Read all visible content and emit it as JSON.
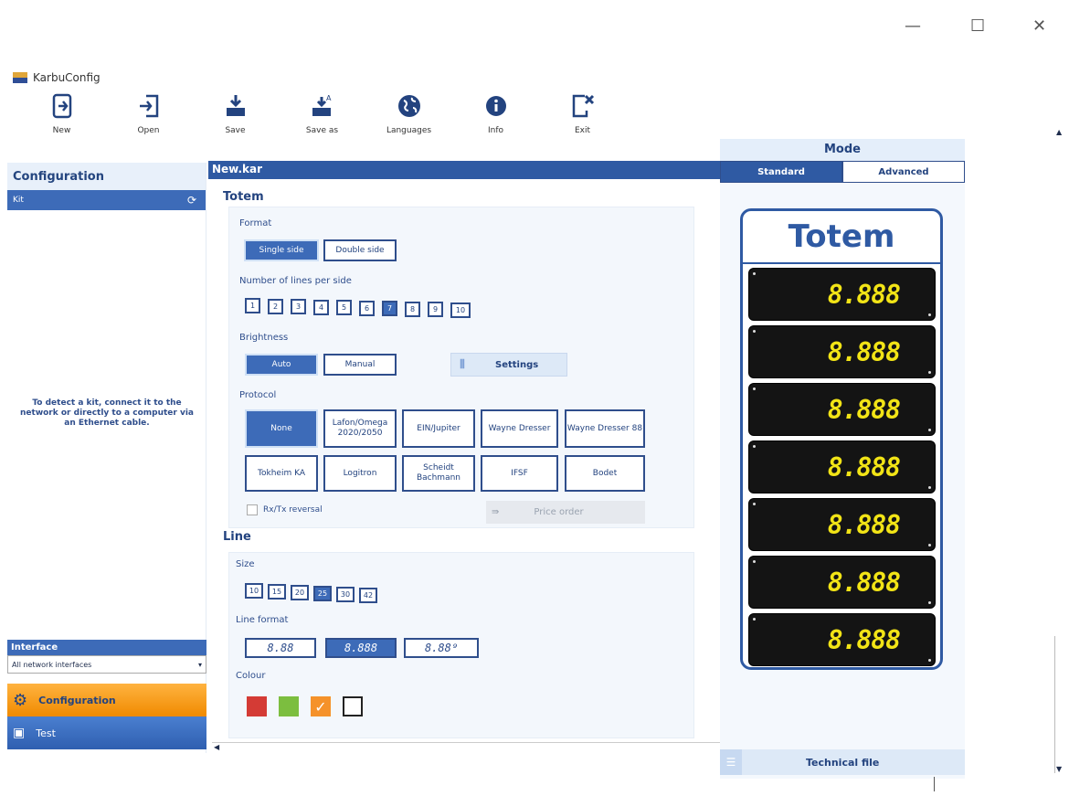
{
  "window": {
    "title": "KarbuConfig",
    "minimize": "—",
    "maximize": "☐",
    "close": "✕"
  },
  "toolbar": [
    {
      "label": "New",
      "icon": "new-file-icon"
    },
    {
      "label": "Open",
      "icon": "open-icon"
    },
    {
      "label": "Save",
      "icon": "save-icon"
    },
    {
      "label": "Save as",
      "icon": "save-as-icon"
    },
    {
      "label": "Languages",
      "icon": "globe-icon"
    },
    {
      "label": "Info",
      "icon": "info-icon"
    },
    {
      "label": "Exit",
      "icon": "exit-icon"
    }
  ],
  "left_panel": {
    "title": "Configuration",
    "kit_label": "Kit",
    "message": "To detect a kit, connect it to the network or directly to a computer via an Ethernet cable.",
    "interface_label": "Interface",
    "interface_value": "All network interfaces",
    "nav_configuration": "Configuration",
    "nav_test": "Test"
  },
  "document": {
    "title": "New.kar",
    "totem_section": "Totem",
    "format_label": "Format",
    "format_options": [
      "Single side",
      "Double side"
    ],
    "format_selected": "Single side",
    "lines_label": "Number of lines per side",
    "lines_options": [
      "1",
      "2",
      "3",
      "4",
      "5",
      "6",
      "7",
      "8",
      "9",
      "10"
    ],
    "lines_selected": "7",
    "brightness_label": "Brightness",
    "brightness_options": [
      "Auto",
      "Manual"
    ],
    "brightness_selected": "Auto",
    "settings_label": "Settings",
    "protocol_label": "Protocol",
    "protocol_row1": [
      "None",
      "Lafon/Omega 2020/2050",
      "EIN/Jupiter",
      "Wayne Dresser",
      "Wayne Dresser 88"
    ],
    "protocol_row2": [
      "Tokheim KA",
      "Logitron",
      "Scheidt Bachmann",
      "IFSF",
      "Bodet"
    ],
    "protocol_selected": "None",
    "rxtx_label": "Rx/Tx reversal",
    "price_order_label": "Price order",
    "line_section": "Line",
    "size_label": "Size",
    "size_options": [
      "10",
      "15",
      "20",
      "25",
      "30",
      "42"
    ],
    "size_selected": "25",
    "line_format_label": "Line format",
    "line_formats": [
      "8.88",
      "8.888",
      "8.88⁹"
    ],
    "line_format_selected": "8.888",
    "colour_label": "Colour",
    "colours": [
      "#d43b35",
      "#7cbe3f",
      "#f5922a",
      "#ffffff"
    ],
    "colour_selected": "#f5922a"
  },
  "mode_panel": {
    "title": "Mode",
    "tabs": [
      "Standard",
      "Advanced"
    ],
    "tab_selected": "Standard",
    "totem_title": "Totem",
    "line_values": [
      "8.888",
      "8.888",
      "8.888",
      "8.888",
      "8.888",
      "8.888",
      "8.888"
    ],
    "technical_file": "Technical file"
  },
  "colors": {
    "accent": "#2f5aa3",
    "highlight": "#f08a00",
    "digit": "#f2e416"
  }
}
